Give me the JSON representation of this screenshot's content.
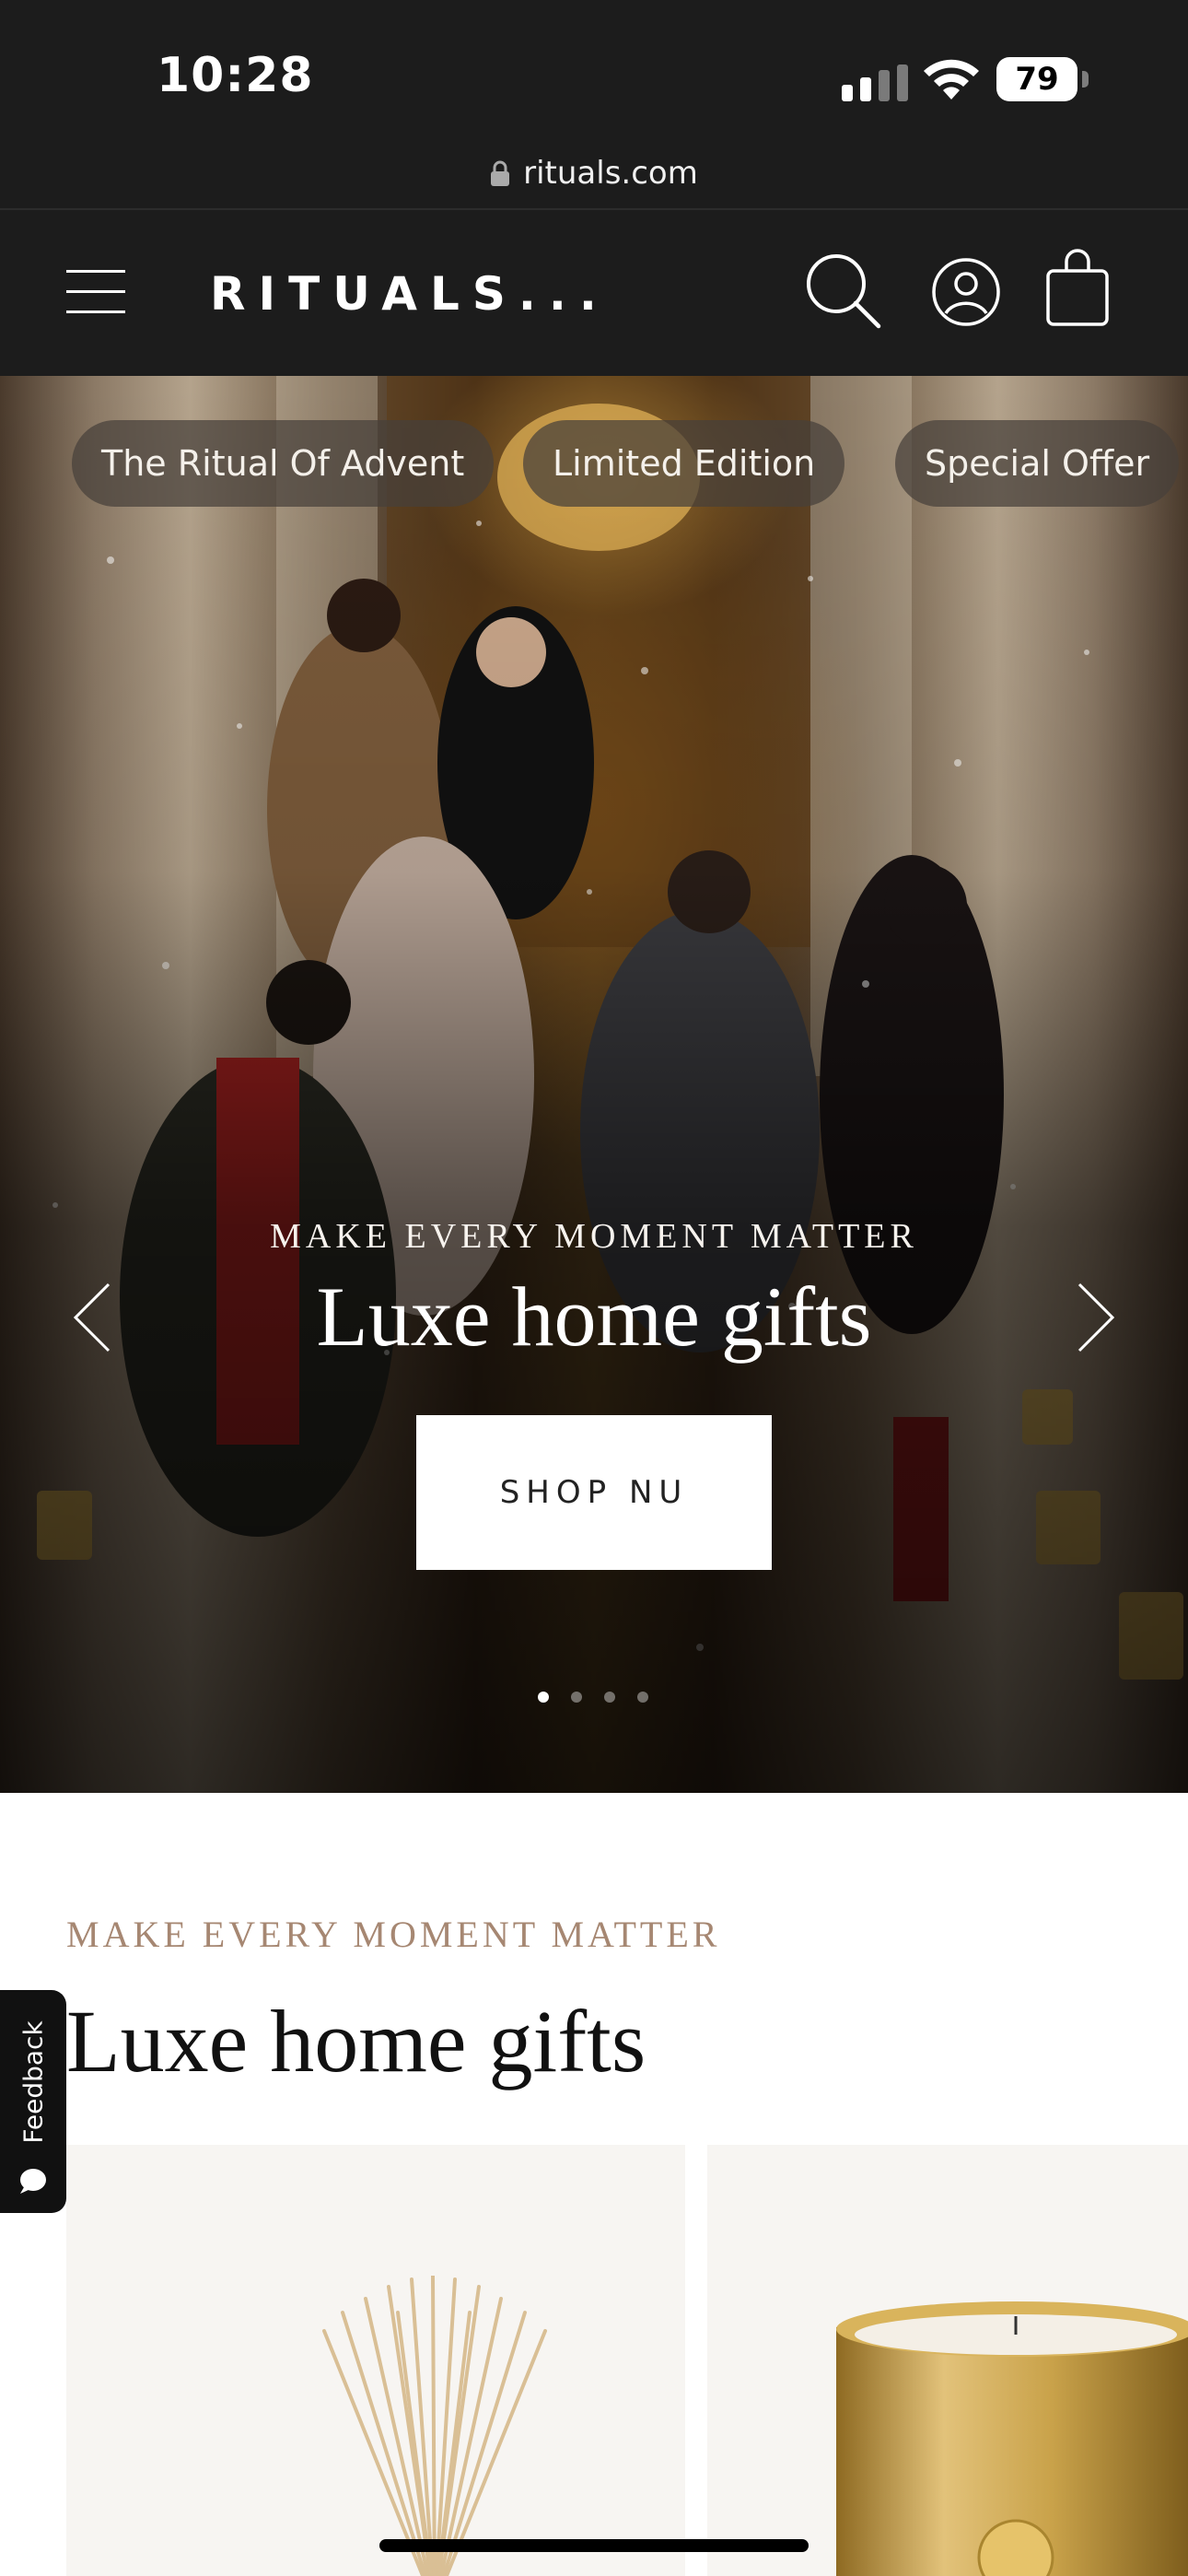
{
  "status_bar": {
    "time": "10:28",
    "battery": "79",
    "icons": [
      "signal-icon",
      "wifi-icon",
      "battery-icon"
    ]
  },
  "browser": {
    "url": "rituals.com"
  },
  "header": {
    "logo": "RITUALS...",
    "icons": [
      "menu-icon",
      "search-icon",
      "account-icon",
      "bag-icon"
    ]
  },
  "hero": {
    "chips": [
      "The Ritual Of Advent",
      "Limited Edition",
      "Special Offer"
    ],
    "eyebrow": "MAKE EVERY MOMENT MATTER",
    "title": "Luxe home gifts",
    "button_label": "SHOP NU",
    "slide_count": 4,
    "active_slide": 1
  },
  "section": {
    "eyebrow": "MAKE EVERY MOMENT MATTER",
    "title": "Luxe home gifts"
  },
  "feedback": {
    "label": "Feedback"
  },
  "colors": {
    "header_bg": "#1c1c1c",
    "eyebrow_accent": "#a68772",
    "card_bg": "#f7f5f2",
    "candle_gold": "#c9a24a"
  }
}
